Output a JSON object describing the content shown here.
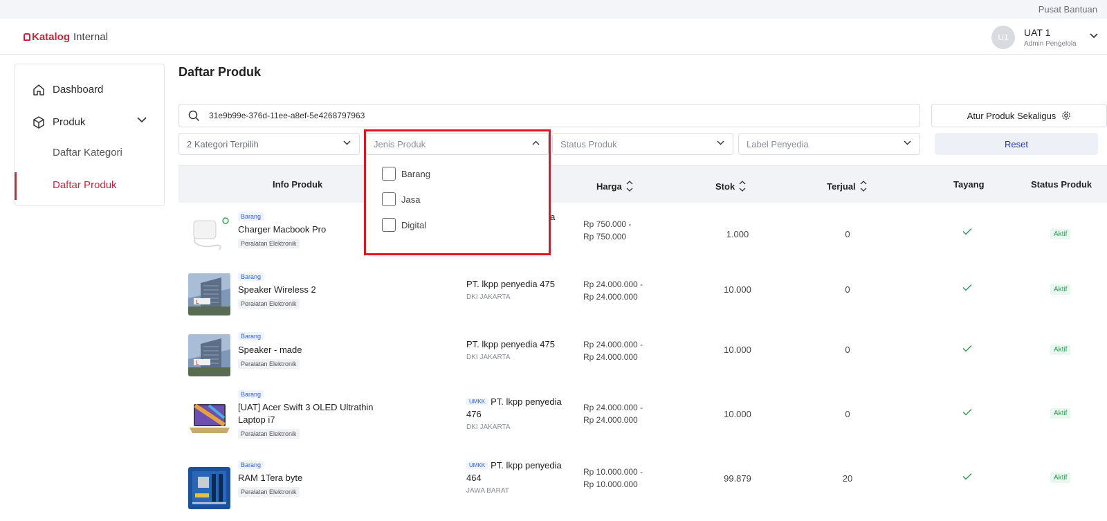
{
  "topbar": {
    "help_link": "Pusat Bantuan"
  },
  "header": {
    "logo_brand": "Katalog",
    "logo_suffix": "Internal",
    "user": {
      "initials": "U1",
      "name": "UAT 1",
      "role": "Admin Pengelola"
    }
  },
  "sidebar": {
    "items": [
      {
        "label": "Dashboard",
        "icon": "home-icon"
      },
      {
        "label": "Produk",
        "icon": "box-icon"
      }
    ],
    "subitems": [
      {
        "label": "Daftar Kategori"
      },
      {
        "label": "Daftar Produk",
        "active": true
      }
    ]
  },
  "page": {
    "title": "Daftar Produk"
  },
  "search": {
    "value": "31e9b99e-376d-11ee-a8ef-5e4268797963"
  },
  "bulk_button": "Atur Produk Sekaligus",
  "filters": {
    "category": "2 Kategori Terpilih",
    "type": "Jenis Produk",
    "status": "Status Produk",
    "label": "Label Penyedia",
    "reset": "Reset"
  },
  "type_dropdown": {
    "options": [
      "Barang",
      "Jasa",
      "Digital"
    ]
  },
  "table": {
    "headers": {
      "info": "Info Produk",
      "price": "Harga",
      "stock": "Stok",
      "sold": "Terjual",
      "live": "Tayang",
      "status": "Status Produk"
    },
    "rows": [
      {
        "type": "Barang",
        "name": "Charger Macbook Pro",
        "category": "Peralatan Elektronik",
        "seller_tail": "dia",
        "price_min": "Rp 750.000 -",
        "price_max": "Rp 750.000",
        "stock": "1.000",
        "sold": "0",
        "status": "Aktif"
      },
      {
        "type": "Barang",
        "name": "Speaker Wireless 2",
        "category": "Peralatan Elektronik",
        "seller": "PT. lkpp penyedia 475",
        "location": "DKI JAKARTA",
        "price_min": "Rp 24.000.000 -",
        "price_max": "Rp 24.000.000",
        "stock": "10.000",
        "sold": "0",
        "status": "Aktif"
      },
      {
        "type": "Barang",
        "name": "Speaker - made",
        "category": "Peralatan Elektronik",
        "seller": "PT. lkpp penyedia 475",
        "location": "DKI JAKARTA",
        "price_min": "Rp 24.000.000 -",
        "price_max": "Rp 24.000.000",
        "stock": "10.000",
        "sold": "0",
        "status": "Aktif"
      },
      {
        "type": "Barang",
        "name": "[UAT] Acer Swift 3 OLED Ultrathin Laptop i7",
        "category": "Peralatan Elektronik",
        "seller_badge": "UMKK",
        "seller": "PT. lkpp penyedia 476",
        "location": "DKI JAKARTA",
        "price_min": "Rp 24.000.000 -",
        "price_max": "Rp 24.000.000",
        "stock": "10.000",
        "sold": "0",
        "status": "Aktif"
      },
      {
        "type": "Barang",
        "name": "RAM 1Tera byte",
        "category": "Peralatan Elektronik",
        "seller_badge": "UMKK",
        "seller": "PT. lkpp penyedia 464",
        "location": "JAWA BARAT",
        "price_min": "Rp 10.000.000 -",
        "price_max": "Rp 10.000.000",
        "stock": "99.879",
        "sold": "20",
        "status": "Aktif"
      }
    ]
  },
  "colors": {
    "brand": "#d6203a",
    "accent": "#2a3a9c",
    "success": "#2d9b55",
    "highlight": "#e0141e"
  }
}
